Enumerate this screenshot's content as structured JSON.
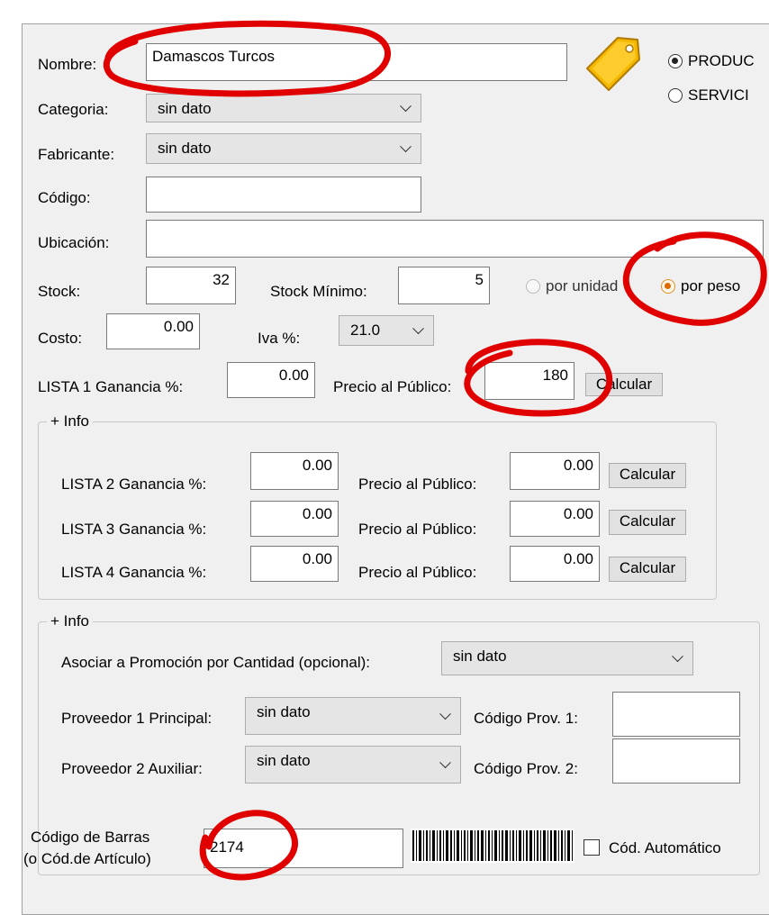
{
  "nombre": {
    "label": "Nombre:",
    "value": "Damascos Turcos"
  },
  "tipo": {
    "producto": "PRODUC",
    "servicio": "SERVICI"
  },
  "categoria": {
    "label": "Categoria:",
    "value": "sin dato"
  },
  "fabricante": {
    "label": "Fabricante:",
    "value": "sin dato"
  },
  "codigo": {
    "label": "Código:",
    "value": ""
  },
  "ubicacion": {
    "label": "Ubicación:",
    "value": ""
  },
  "stock": {
    "label": "Stock:",
    "value": "32",
    "min_label": "Stock Mínimo:",
    "min_value": "5",
    "por_unidad": "por unidad",
    "por_peso": "por peso"
  },
  "costo": {
    "label": "Costo:",
    "value": "0.00",
    "iva_label": "Iva %:",
    "iva_value": "21.0"
  },
  "lista1": {
    "label": "LISTA 1 Ganancia %:",
    "ganancia": "0.00",
    "precio_label": "Precio al Público:",
    "precio": "180",
    "calcular": "Calcular"
  },
  "info1": {
    "title": "+ Info",
    "rows": [
      {
        "label": "LISTA 2 Ganancia %:",
        "ganancia": "0.00",
        "precio_label": "Precio al Público:",
        "precio": "0.00",
        "calcular": "Calcular"
      },
      {
        "label": "LISTA 3 Ganancia %:",
        "ganancia": "0.00",
        "precio_label": "Precio al Público:",
        "precio": "0.00",
        "calcular": "Calcular"
      },
      {
        "label": "LISTA 4 Ganancia %:",
        "ganancia": "0.00",
        "precio_label": "Precio al Público:",
        "precio": "0.00",
        "calcular": "Calcular"
      }
    ]
  },
  "info2": {
    "title": "+ Info",
    "promo_label": "Asociar a Promoción por Cantidad (opcional):",
    "promo_value": "sin dato",
    "prov1_label": "Proveedor 1 Principal:",
    "prov1_value": "sin dato",
    "codprov1_label": "Código Prov. 1:",
    "codprov1_value": "",
    "prov2_label": "Proveedor 2 Auxiliar:",
    "prov2_value": "sin dato",
    "codprov2_label": "Código Prov. 2:",
    "codprov2_value": ""
  },
  "barras": {
    "label1": "Código de Barras",
    "label2": "(o Cód.de Artículo)",
    "value": "2174",
    "auto_label": "Cód. Automático"
  },
  "colors": {
    "annotation": "#e00000",
    "tag": "#f5b800"
  }
}
